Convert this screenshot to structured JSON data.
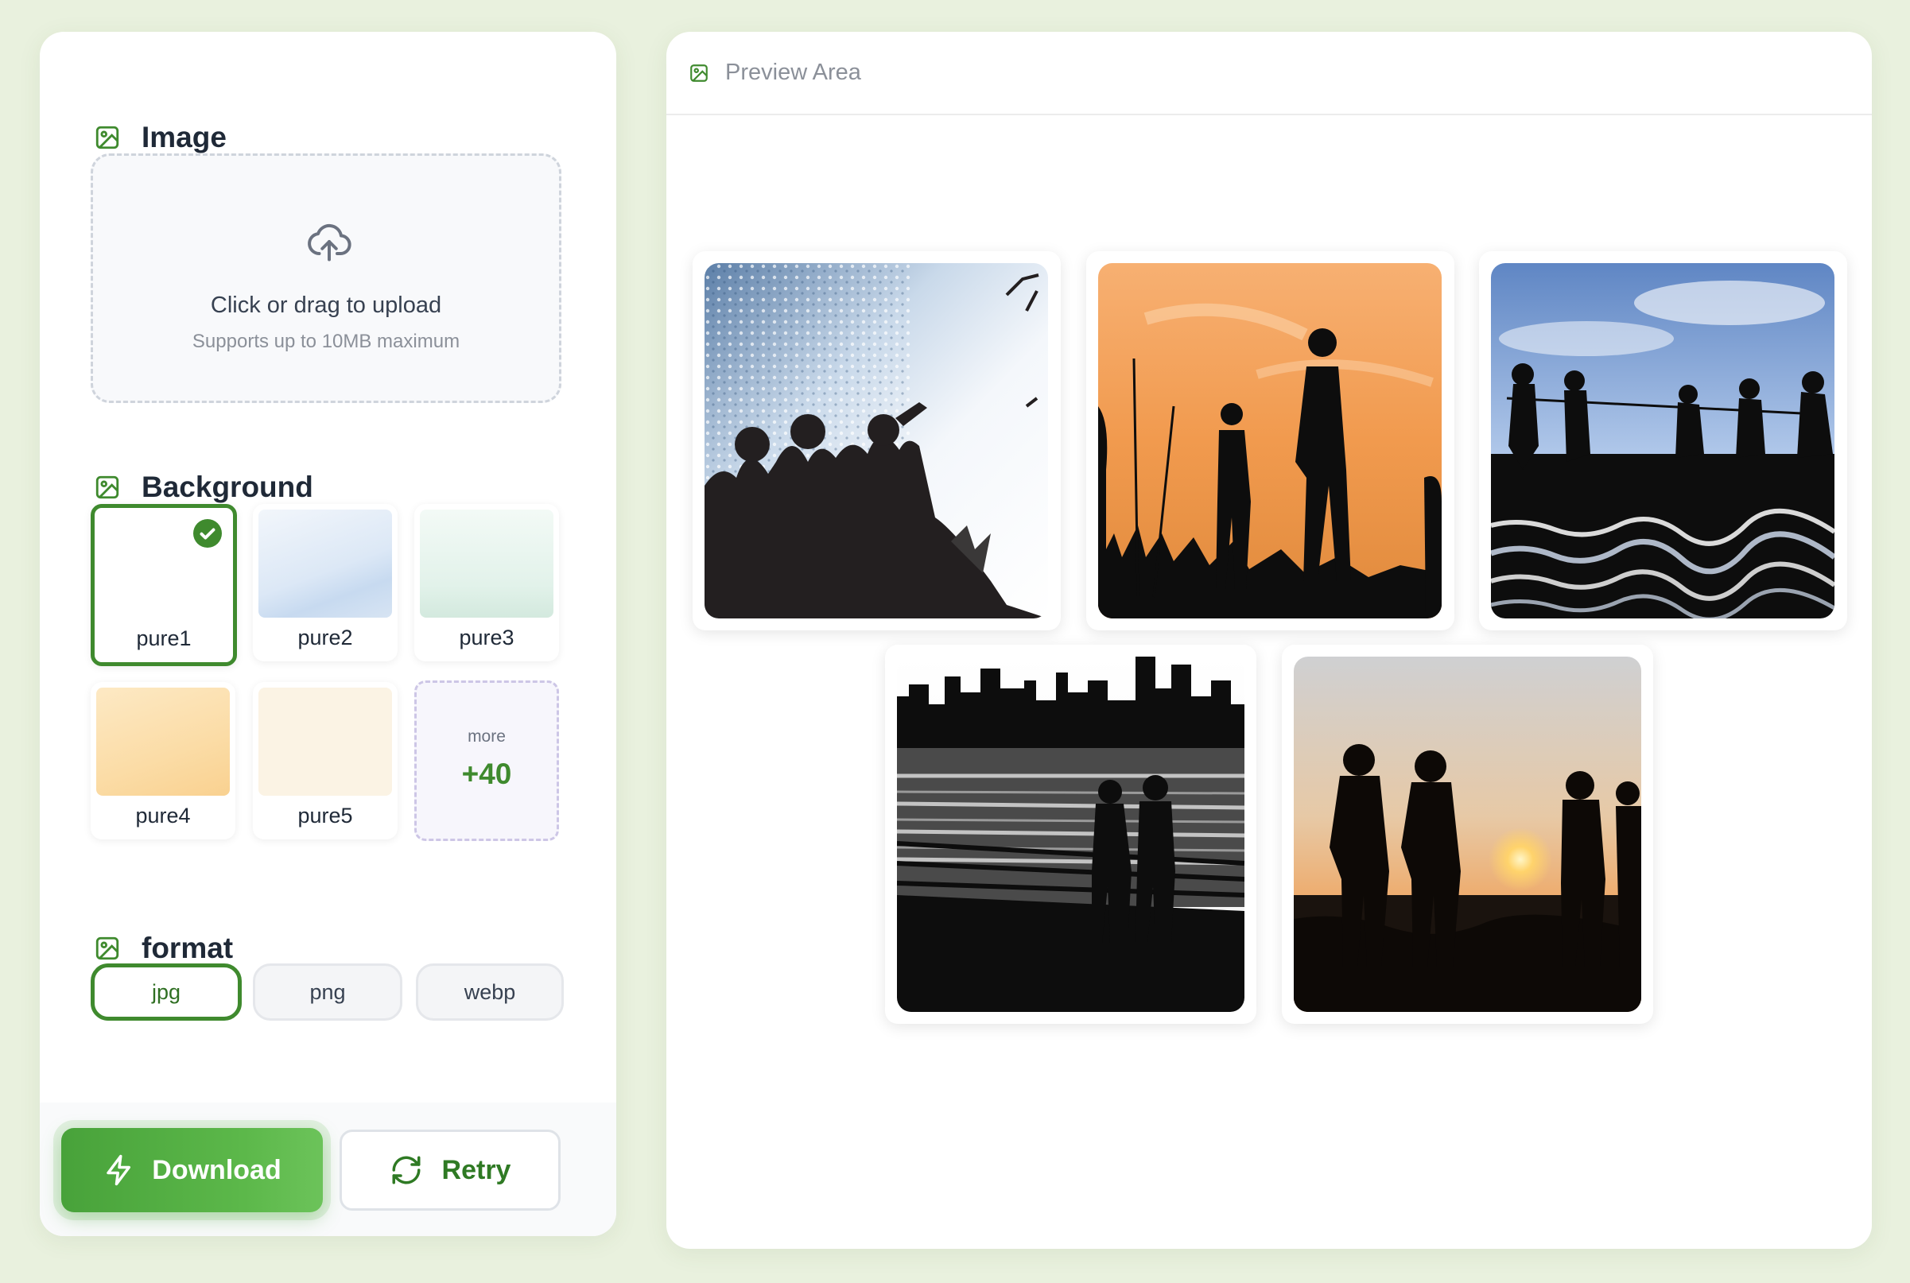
{
  "left": {
    "image_section": {
      "title": "Image",
      "upload_main": "Click or drag to upload",
      "upload_sub": "Supports up to 10MB maximum"
    },
    "background_section": {
      "title": "Background",
      "tiles": [
        {
          "label": "pure1",
          "selected": true
        },
        {
          "label": "pure2"
        },
        {
          "label": "pure3"
        },
        {
          "label": "pure4"
        },
        {
          "label": "pure5"
        }
      ],
      "more_label": "more",
      "more_count": "+40"
    },
    "format_section": {
      "title": "format",
      "options": [
        "jpg",
        "png",
        "webp"
      ],
      "selected": "jpg"
    },
    "actions": {
      "download_label": "Download",
      "retry_label": "Retry"
    }
  },
  "preview": {
    "title": "Preview Area",
    "photos": [
      {
        "subject": "silhouettes of people sitting by sparkling water"
      },
      {
        "subject": "silhouettes against orange sunset sky"
      },
      {
        "subject": "tug of war silhouettes by water"
      },
      {
        "subject": "couple silhouettes by city waterfront"
      },
      {
        "subject": "people silhouettes watching sunset"
      }
    ]
  },
  "colors": {
    "accent": "#3f8a2e",
    "accent_light": "#5cb84a",
    "page_bg": "#e9f1de"
  },
  "icons": {
    "section_icon": "image-icon",
    "upload_icon": "cloud-upload-icon",
    "download_icon": "lightning-icon",
    "retry_icon": "refresh-icon",
    "selected_icon": "check-icon"
  }
}
